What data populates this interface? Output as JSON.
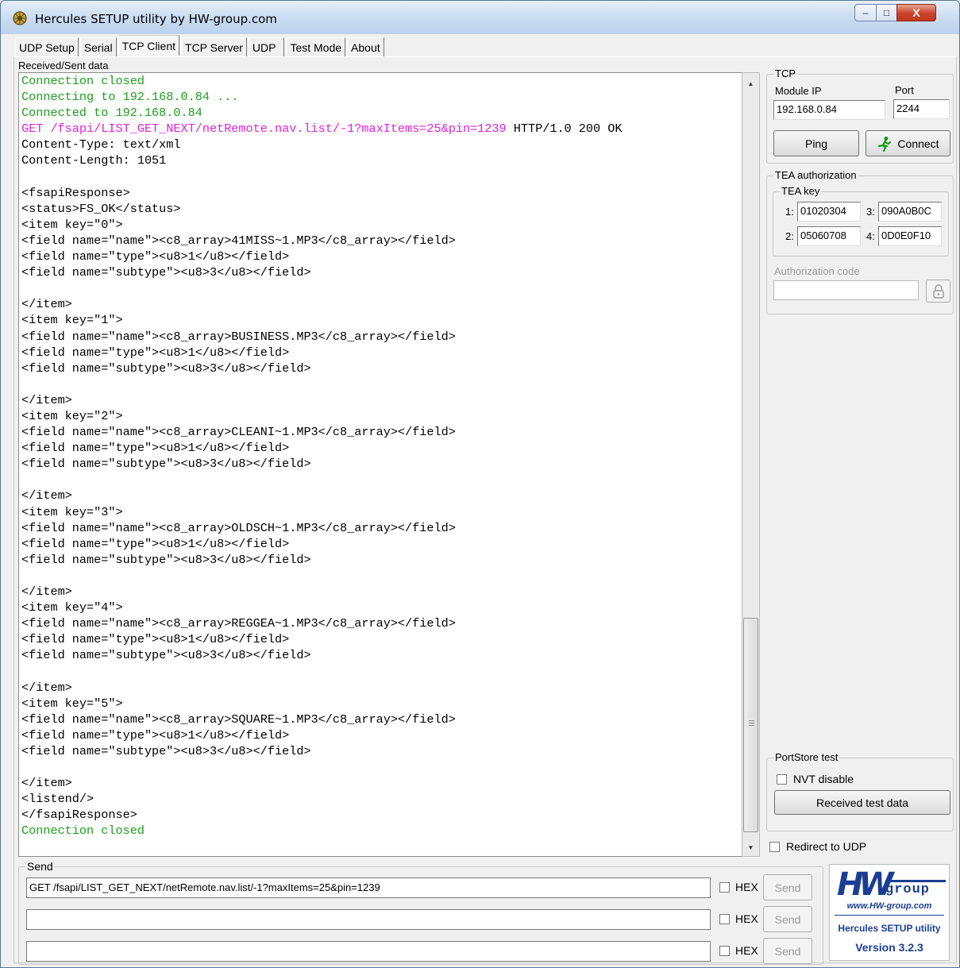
{
  "window": {
    "title": "Hercules SETUP utility by HW-group.com",
    "minimize_glyph": "–",
    "maximize_glyph": "□",
    "close_glyph": "X"
  },
  "tabs": [
    {
      "label": "UDP Setup",
      "active": false
    },
    {
      "label": "Serial",
      "active": false
    },
    {
      "label": "TCP Client",
      "active": true
    },
    {
      "label": "TCP Server",
      "active": false
    },
    {
      "label": "UDP",
      "active": false
    },
    {
      "label": "Test Mode",
      "active": false
    },
    {
      "label": "About",
      "active": false
    }
  ],
  "received": {
    "label": "Received/Sent data",
    "lines": [
      {
        "text": "Connection closed",
        "color": "#1ba01b"
      },
      {
        "text": "Connecting to 192.168.0.84 ...",
        "color": "#1ba01b"
      },
      {
        "text": "Connected to 192.168.0.84",
        "color": "#1ba01b"
      },
      {
        "text": "GET /fsapi/LIST_GET_NEXT/netRemote.nav.list/-1?maxItems=25&pin=1239",
        "color": "#e020e0",
        "suffix": " HTTP/1.0 200 OK"
      },
      {
        "text": "Content-Type: text/xml",
        "color": "#000000"
      },
      {
        "text": "Content-Length: 1051",
        "color": "#000000"
      },
      {
        "text": "",
        "color": "#000000"
      },
      {
        "text": "<fsapiResponse>",
        "color": "#000000"
      },
      {
        "text": "<status>FS_OK</status>",
        "color": "#000000"
      },
      {
        "text": "<item key=\"0\">",
        "color": "#000000"
      },
      {
        "text": "<field name=\"name\"><c8_array>41MISS~1.MP3</c8_array></field>",
        "color": "#000000"
      },
      {
        "text": "<field name=\"type\"><u8>1</u8></field>",
        "color": "#000000"
      },
      {
        "text": "<field name=\"subtype\"><u8>3</u8></field>",
        "color": "#000000"
      },
      {
        "text": "",
        "color": "#000000"
      },
      {
        "text": "</item>",
        "color": "#000000"
      },
      {
        "text": "<item key=\"1\">",
        "color": "#000000"
      },
      {
        "text": "<field name=\"name\"><c8_array>BUSINESS.MP3</c8_array></field>",
        "color": "#000000"
      },
      {
        "text": "<field name=\"type\"><u8>1</u8></field>",
        "color": "#000000"
      },
      {
        "text": "<field name=\"subtype\"><u8>3</u8></field>",
        "color": "#000000"
      },
      {
        "text": "",
        "color": "#000000"
      },
      {
        "text": "</item>",
        "color": "#000000"
      },
      {
        "text": "<item key=\"2\">",
        "color": "#000000"
      },
      {
        "text": "<field name=\"name\"><c8_array>CLEANI~1.MP3</c8_array></field>",
        "color": "#000000"
      },
      {
        "text": "<field name=\"type\"><u8>1</u8></field>",
        "color": "#000000"
      },
      {
        "text": "<field name=\"subtype\"><u8>3</u8></field>",
        "color": "#000000"
      },
      {
        "text": "",
        "color": "#000000"
      },
      {
        "text": "</item>",
        "color": "#000000"
      },
      {
        "text": "<item key=\"3\">",
        "color": "#000000"
      },
      {
        "text": "<field name=\"name\"><c8_array>OLDSCH~1.MP3</c8_array></field>",
        "color": "#000000"
      },
      {
        "text": "<field name=\"type\"><u8>1</u8></field>",
        "color": "#000000"
      },
      {
        "text": "<field name=\"subtype\"><u8>3</u8></field>",
        "color": "#000000"
      },
      {
        "text": "",
        "color": "#000000"
      },
      {
        "text": "</item>",
        "color": "#000000"
      },
      {
        "text": "<item key=\"4\">",
        "color": "#000000"
      },
      {
        "text": "<field name=\"name\"><c8_array>REGGEA~1.MP3</c8_array></field>",
        "color": "#000000"
      },
      {
        "text": "<field name=\"type\"><u8>1</u8></field>",
        "color": "#000000"
      },
      {
        "text": "<field name=\"subtype\"><u8>3</u8></field>",
        "color": "#000000"
      },
      {
        "text": "",
        "color": "#000000"
      },
      {
        "text": "</item>",
        "color": "#000000"
      },
      {
        "text": "<item key=\"5\">",
        "color": "#000000"
      },
      {
        "text": "<field name=\"name\"><c8_array>SQUARE~1.MP3</c8_array></field>",
        "color": "#000000"
      },
      {
        "text": "<field name=\"type\"><u8>1</u8></field>",
        "color": "#000000"
      },
      {
        "text": "<field name=\"subtype\"><u8>3</u8></field>",
        "color": "#000000"
      },
      {
        "text": "",
        "color": "#000000"
      },
      {
        "text": "</item>",
        "color": "#000000"
      },
      {
        "text": "<listend/>",
        "color": "#000000"
      },
      {
        "text": "</fsapiResponse>",
        "color": "#000000"
      },
      {
        "text": "Connection closed",
        "color": "#1ba01b"
      }
    ]
  },
  "tcp": {
    "group_title": "TCP",
    "module_ip_label": "Module IP",
    "module_ip_value": "192.168.0.84",
    "port_label": "Port",
    "port_value": "2244",
    "ping_label": "Ping",
    "connect_label": "Connect",
    "connect_icon": "running-man-icon"
  },
  "tea": {
    "group_title": "TEA authorization",
    "key_group_title": "TEA key",
    "keys": [
      {
        "label": "1:",
        "value": "01020304"
      },
      {
        "label": "3:",
        "value": "090A0B0C"
      },
      {
        "label": "2:",
        "value": "05060708"
      },
      {
        "label": "4:",
        "value": "0D0E0F10"
      }
    ],
    "auth_code_label": "Authorization code",
    "auth_code_value": "",
    "lock_icon": "lock-icon"
  },
  "portstore": {
    "group_title": "PortStore test",
    "nvt_label": "NVT disable",
    "nvt_checked": false,
    "received_test_label": "Received test data"
  },
  "redirect": {
    "label": "Redirect to UDP",
    "checked": false
  },
  "send": {
    "group_title": "Send",
    "rows": [
      {
        "value": "GET /fsapi/LIST_GET_NEXT/netRemote.nav.list/-1?maxItems=25&pin=1239",
        "hex_label": "HEX",
        "hex_checked": false,
        "send_label": "Send"
      },
      {
        "value": "",
        "hex_label": "HEX",
        "hex_checked": false,
        "send_label": "Send"
      },
      {
        "value": "",
        "hex_label": "HEX",
        "hex_checked": false,
        "send_label": "Send"
      }
    ]
  },
  "logo": {
    "big": "HW",
    "group": "group",
    "url": "www.HW-group.com",
    "name": "Hercules SETUP utility",
    "version": "Version  3.2.3",
    "brand_color": "#1b3e93"
  }
}
